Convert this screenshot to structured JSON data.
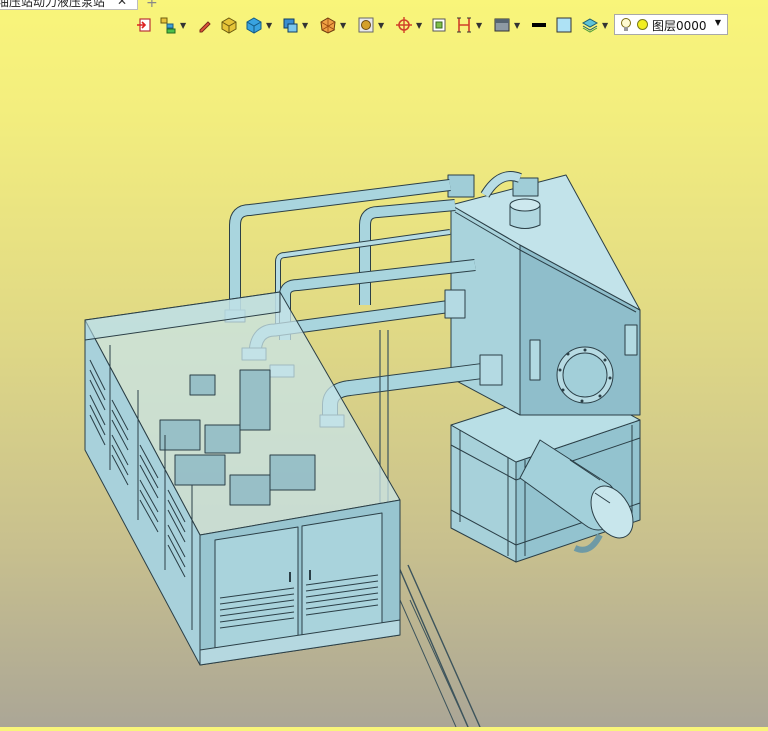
{
  "document_tab": {
    "title": "油压站动力液压泵站",
    "close_glyph": "✕",
    "add_glyph": "+"
  },
  "toolbar": {
    "icons": [
      "exit-sketch-icon",
      "assembly-tree-icon",
      "pencil-icon",
      "cube-3d-icon",
      "solid-block-icon",
      "display-style-icon",
      "section-view-icon",
      "render-material-icon",
      "view-orientation-icon",
      "fit-view-icon",
      "dimension-icon",
      "background-icon",
      "line-color-icon",
      "fill-color-icon",
      "layer-stack-icon"
    ],
    "line_color": "#000000",
    "fill_color": "#aee2f5"
  },
  "layer_selector": {
    "label": "图层0000",
    "bulb_icon": "lightbulb-icon",
    "layer_color": "#f2ee22"
  },
  "viewport": {
    "background_top": "#f9f57a",
    "background_bottom": "#aba696",
    "model_color": "#9ccbd6",
    "model_edge_color": "#2b3f47"
  }
}
